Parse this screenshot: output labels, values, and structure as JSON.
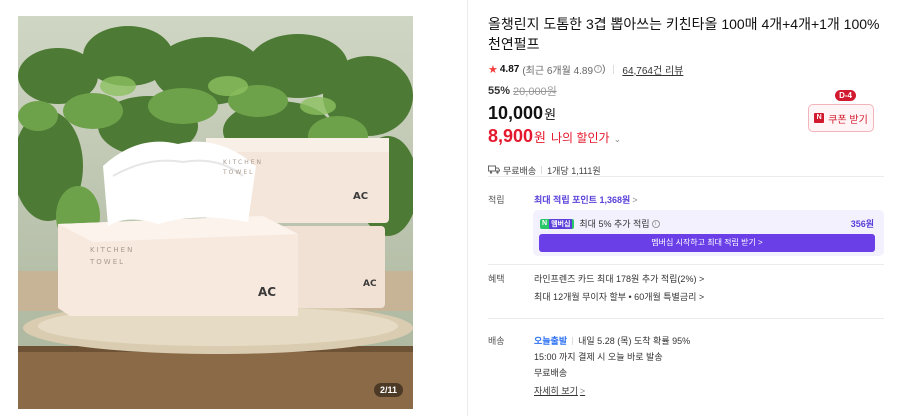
{
  "gallery": {
    "counter": "2/11",
    "box_text_front": "KITCHEN\nTOWEL",
    "box_logo": "AC"
  },
  "product": {
    "title": "올챙린지 도톰한 3겹 뽑아쓰는 키친타올 100매 4개+4개+1개 100% 천연펄프",
    "rating_score": "4.87",
    "rating_sub": "(최근 6개월 4.89",
    "rating_sub_close": ")",
    "rating_info": "i",
    "reviews": "64,764건 리뷰"
  },
  "price": {
    "discount_pct": "55%",
    "original": "20,000원",
    "price": "10,000",
    "price_unit": "원",
    "sale": "8,900",
    "sale_unit": "원",
    "sale_label": "나의 할인가",
    "sale_chevron": "⌄",
    "coupon_badge": "D-4",
    "coupon_n": "N",
    "coupon_label": "쿠폰 받기"
  },
  "shipping_summary": {
    "free": "무료배송",
    "unit_price": "1개당 1,111원"
  },
  "points": {
    "label": "적립",
    "max_points": "최대 적립 포인트 1,368원",
    "chevron": ">",
    "npay": "N",
    "membership_tag": "멤버십",
    "membership_text": "최대 5% 추가 적립",
    "membership_info": "i",
    "membership_amount": "356원",
    "membership_button": "멤버십 시작하고 최대 적립 받기 >"
  },
  "benefits": {
    "label": "혜택",
    "card": "라인프렌즈 카드 최대 178원 추가 적립(2%) >",
    "installment": "최대 12개월 무이자 할부 • 60개월 특별금리 >"
  },
  "delivery": {
    "label": "배송",
    "today": "오늘출발",
    "arrival": "내일 5.28 (목) 도착 확률 95%",
    "cutoff": "15:00 까지 결제 시 오늘 바로 발송",
    "fee": "무료배송",
    "more": "자세히 보기",
    "more_chevron": ">"
  },
  "colors": {
    "sale_red": "#e5192d",
    "purple": "#5a3fd8",
    "membership_button": "#6a3fe8",
    "today_blue": "#2b6ff2"
  }
}
